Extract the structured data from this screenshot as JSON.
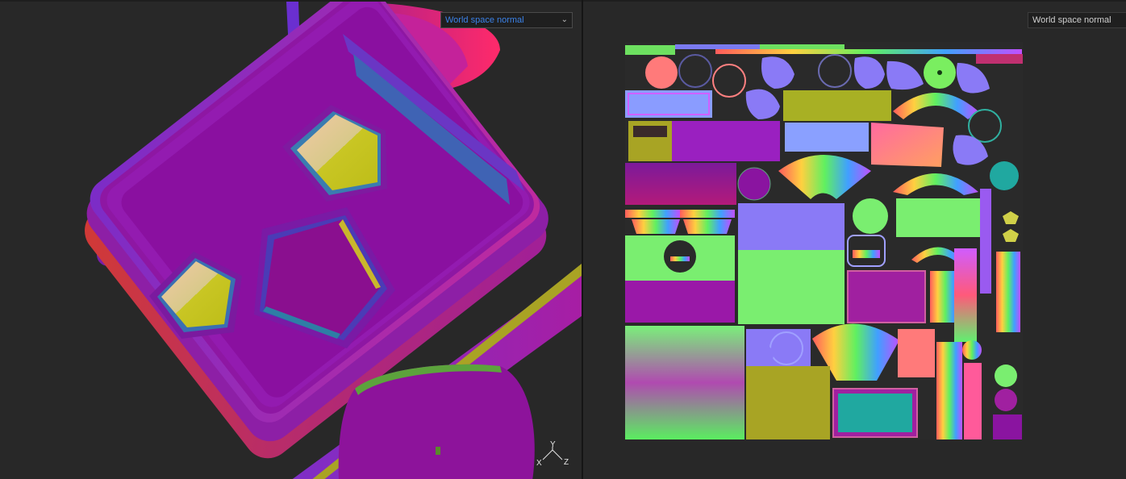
{
  "viewport_3d": {
    "mode_select": {
      "value": "World space normal"
    },
    "gizmo": {
      "y": "Y",
      "x": "X",
      "z": "Z"
    }
  },
  "viewport_2d": {
    "mode_select": {
      "value": "World space normal"
    }
  },
  "icons": {
    "dropdown": "chevron-down-icon"
  }
}
